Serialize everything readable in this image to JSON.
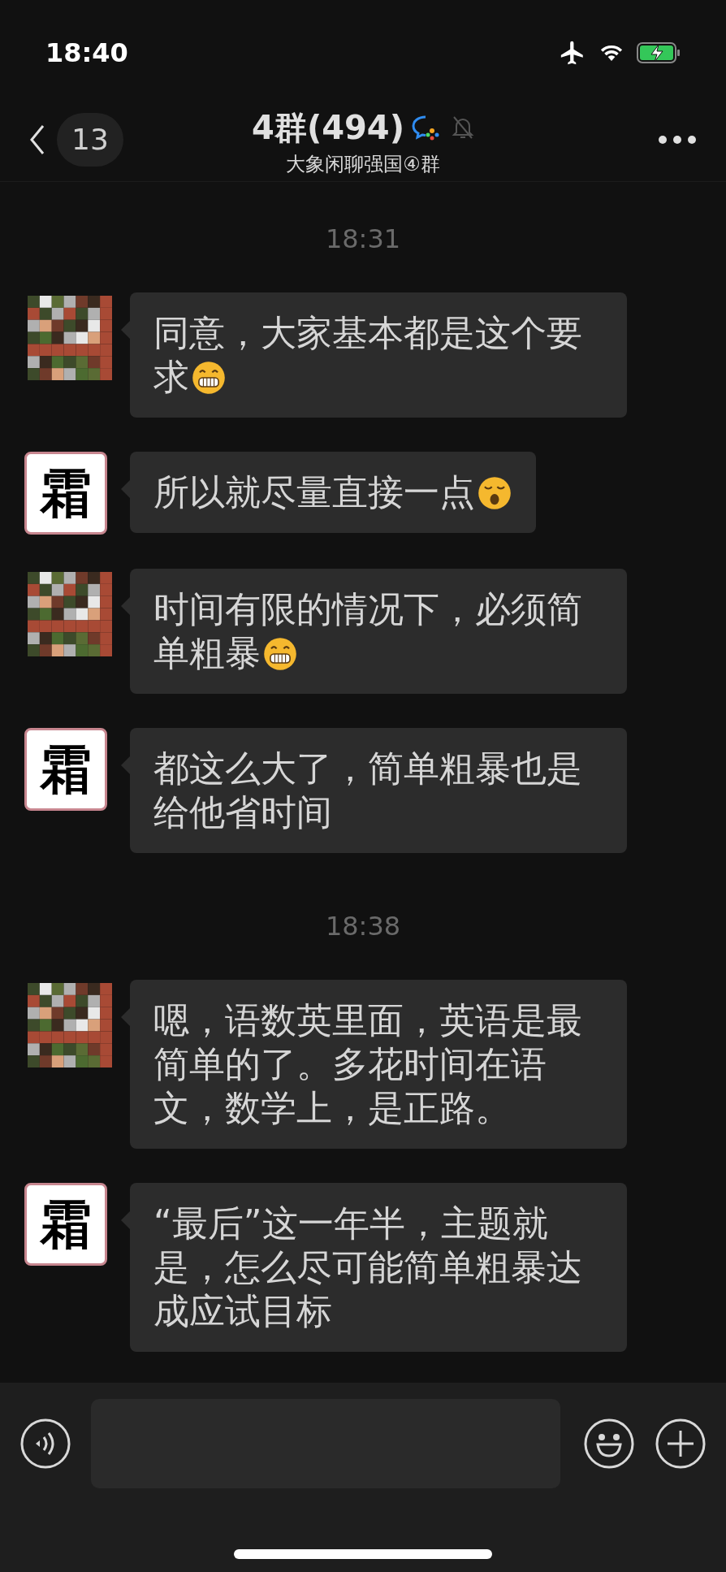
{
  "status_bar": {
    "time": "18:40",
    "airplane_mode": true,
    "battery_charging": true
  },
  "nav": {
    "back_count": "13",
    "title": "4群(494)",
    "subtitle": "大象闲聊强国④群",
    "muted": true
  },
  "messages": [
    {
      "kind": "time",
      "text": "18:31"
    },
    {
      "kind": "msg",
      "text": "同意，大家基本都是这个要求",
      "emoji": {
        "kind": "grin"
      }
    },
    {
      "kind": "msg",
      "avatar": {
        "kind": "char",
        "text": "霜"
      },
      "text": "所以就尽量直接一点",
      "emoji": {
        "kind": "yawn"
      }
    },
    {
      "kind": "msg",
      "text": "时间有限的情况下，必须简单粗暴",
      "emoji": {
        "kind": "grin"
      }
    },
    {
      "kind": "msg",
      "avatar": {
        "kind": "char",
        "text": "霜"
      },
      "text": "都这么大了，简单粗暴也是给他省时间"
    },
    {
      "kind": "time",
      "text": "18:38"
    },
    {
      "kind": "msg",
      "text": "嗯，语数英里面，英语是最简单的了。多花时间在语文，数学上，是正路。"
    },
    {
      "kind": "msg",
      "avatar": {
        "kind": "char",
        "text": "霜"
      },
      "text": "“最后”这一年半，主题就是，怎么尽可能简单粗暴达成应试目标"
    }
  ]
}
